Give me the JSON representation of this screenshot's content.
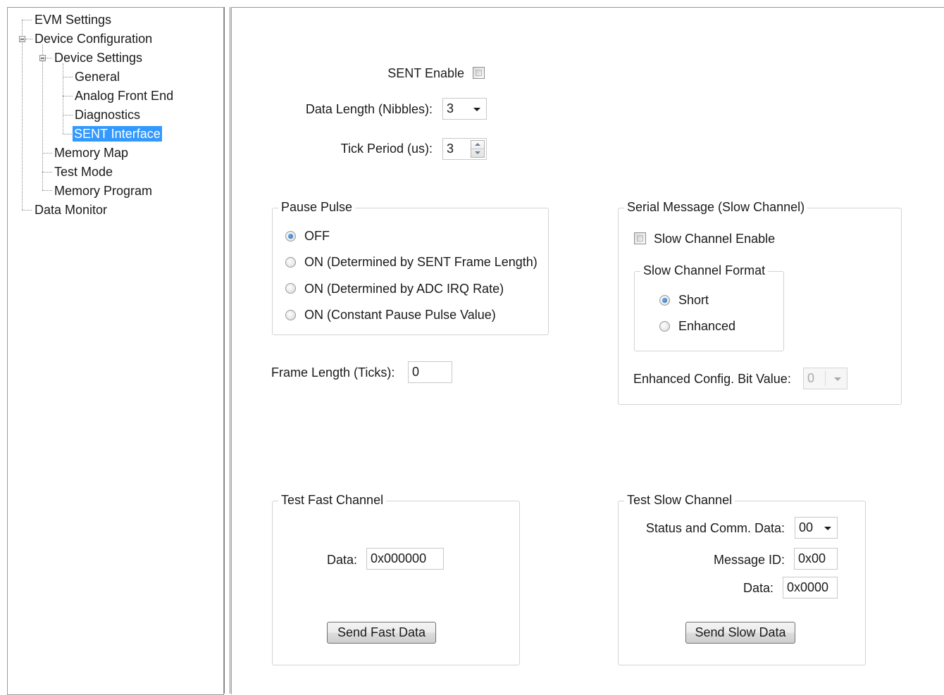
{
  "tree": {
    "items": [
      {
        "label": "EVM Settings"
      },
      {
        "label": "Device Configuration"
      },
      {
        "label": "Device Settings"
      },
      {
        "label": "General"
      },
      {
        "label": "Analog Front End"
      },
      {
        "label": "Diagnostics"
      },
      {
        "label": "SENT Interface"
      },
      {
        "label": "Memory Map"
      },
      {
        "label": "Test Mode"
      },
      {
        "label": "Memory Program"
      },
      {
        "label": "Data Monitor"
      }
    ],
    "selected": "SENT Interface"
  },
  "sent": {
    "enable_label": "SENT Enable",
    "enabled": false,
    "data_length_label": "Data Length (Nibbles):",
    "data_length_value": "3",
    "tick_period_label": "Tick Period (us):",
    "tick_period_value": "3"
  },
  "pause_pulse": {
    "title": "Pause Pulse",
    "options": [
      {
        "label": "OFF",
        "checked": true
      },
      {
        "label": "ON (Determined by SENT Frame Length)",
        "checked": false
      },
      {
        "label": "ON (Determined by ADC IRQ Rate)",
        "checked": false
      },
      {
        "label": "ON (Constant Pause Pulse Value)",
        "checked": false
      }
    ],
    "frame_length_label": "Frame Length (Ticks):",
    "frame_length_value": "0"
  },
  "serial_message": {
    "title": "Serial Message (Slow Channel)",
    "slow_channel_enable_label": "Slow Channel Enable",
    "slow_channel_enabled": false,
    "format_title": "Slow Channel Format",
    "format_options": [
      {
        "label": "Short",
        "checked": true
      },
      {
        "label": "Enhanced",
        "checked": false
      }
    ],
    "enhanced_bit_label": "Enhanced Config. Bit Value:",
    "enhanced_bit_value": "0"
  },
  "test_fast": {
    "title": "Test Fast Channel",
    "data_label": "Data:",
    "data_value": "0x000000",
    "button_label": "Send Fast Data"
  },
  "test_slow": {
    "title": "Test Slow Channel",
    "status_label": "Status and Comm. Data:",
    "status_value": "00",
    "message_id_label": "Message ID:",
    "message_id_value": "0x00",
    "data_label": "Data:",
    "data_value": "0x0000",
    "button_label": "Send Slow Data"
  },
  "colors": {
    "selection": "#3399ff",
    "radio_dot": "#1b5ea8"
  }
}
